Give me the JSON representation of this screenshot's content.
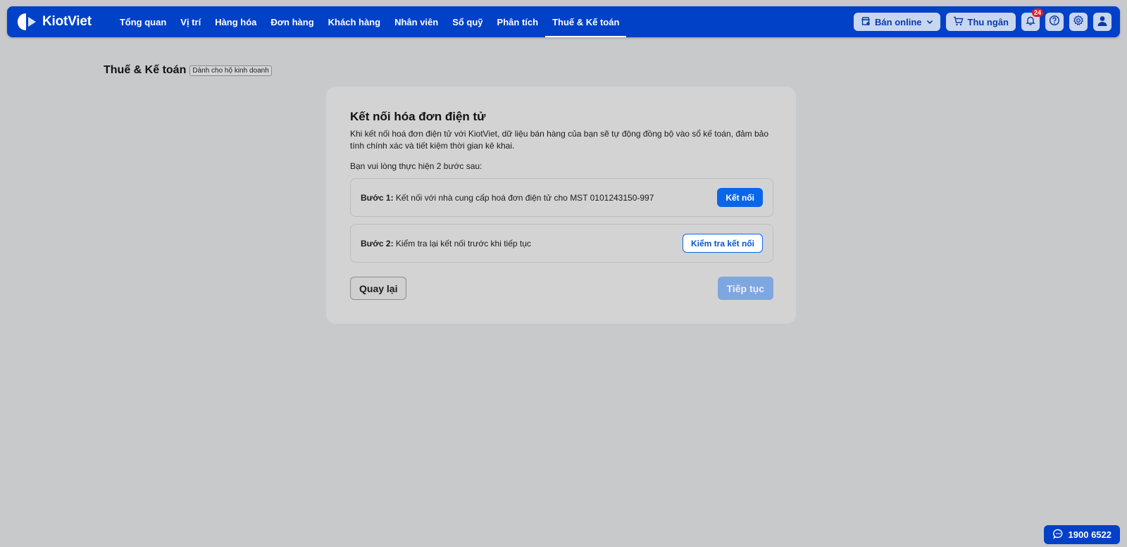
{
  "app": {
    "logo_text": "KiotViet"
  },
  "nav": {
    "items": [
      {
        "label": "Tổng quan"
      },
      {
        "label": "Vị trí"
      },
      {
        "label": "Hàng hóa"
      },
      {
        "label": "Đơn hàng"
      },
      {
        "label": "Khách hàng"
      },
      {
        "label": "Nhân viên"
      },
      {
        "label": "Sổ quỹ"
      },
      {
        "label": "Phân tích"
      },
      {
        "label": "Thuế & Kế toán"
      }
    ],
    "active_index": 8,
    "ban_online_label": "Bán online",
    "thu_ngan_label": "Thu ngân",
    "notification_count": "24"
  },
  "page": {
    "title": "Thuế & Kế toán",
    "tag": "Dành cho hộ kinh doanh"
  },
  "card": {
    "title": "Kết nối hóa đơn điện tử",
    "description": "Khi kết nối hoá đơn điện tử với KiotViet, dữ liệu bán hàng của bạn sẽ tự động đồng bộ vào sổ kế toán, đảm bảo tính chính xác và tiết kiệm thời gian kê khai.",
    "instruction": "Bạn vui lòng thực hiện 2 bước sau:",
    "step1": {
      "label": "Bước 1:",
      "text": "Kết nối với nhà cung cấp hoá đơn điện tử cho MST 0101243150-997",
      "button": "Kết nối"
    },
    "step2": {
      "label": "Bước 2:",
      "text": "Kiểm tra lại kết nối trước khi tiếp tục",
      "button": "Kiểm tra kết nối"
    },
    "back_button": "Quay lại",
    "next_button": "Tiếp tục"
  },
  "hotline": {
    "number": "1900 6522"
  },
  "colors": {
    "brand": "#0041c8",
    "primary": "#0a66e8",
    "background": "#c8c9cb"
  }
}
